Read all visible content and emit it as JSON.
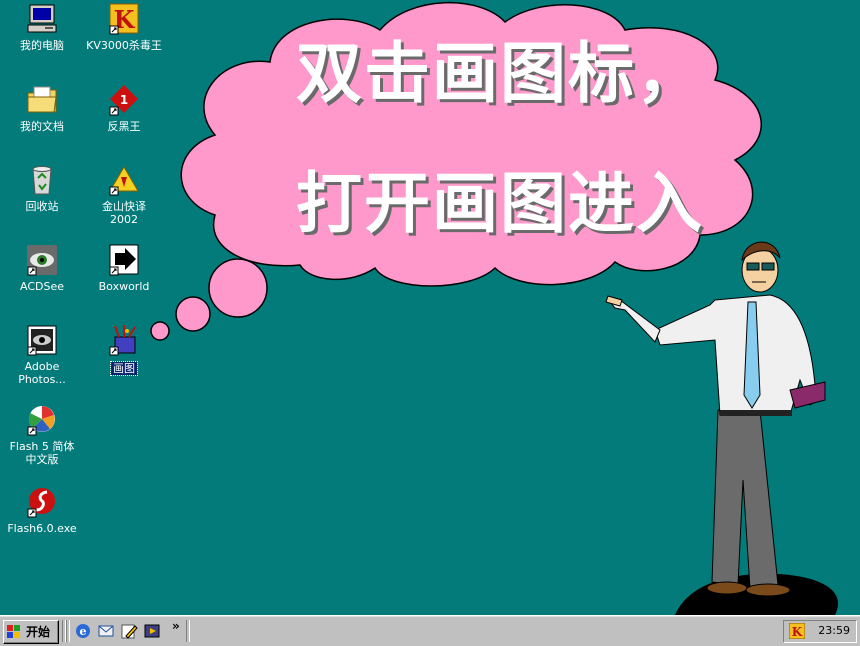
{
  "desktop": {
    "icons": [
      {
        "label": "我的电脑",
        "icon": "my-computer-icon"
      },
      {
        "label": "KV3000杀毒王",
        "icon": "kv3000-antivirus-icon"
      },
      {
        "label": "我的文档",
        "icon": "my-documents-folder-icon"
      },
      {
        "label": "反黑王",
        "icon": "anti-hacker-icon"
      },
      {
        "label": "回收站",
        "icon": "recycle-bin-icon"
      },
      {
        "label": "金山快译\n2002",
        "icon": "kingsoft-translator-icon"
      },
      {
        "label": "ACDSee",
        "icon": "acdsee-eye-icon"
      },
      {
        "label": "Boxworld",
        "icon": "boxworld-arrow-icon"
      },
      {
        "label": "Adobe\nPhotos...",
        "icon": "photoshop-eye-icon"
      },
      {
        "label": "画图",
        "icon": "paint-icon"
      },
      {
        "label": "Flash 5 简体\n中文版",
        "icon": "flash5-icon"
      },
      {
        "label": "Flash6.0.exe",
        "icon": "flash6-icon"
      }
    ]
  },
  "callout": {
    "line1": "双击画图标，",
    "line2": "打开画图进入",
    "color": "#ff99cc"
  },
  "taskbar": {
    "start_label": "开始",
    "quicklaunch": [
      "internet-explorer-icon",
      "outlook-express-icon",
      "edit-icon",
      "media-icon"
    ],
    "more": "»",
    "clock": "23:59"
  },
  "colors": {
    "desktop": "#027b7a",
    "taskbar": "#c0c0c0"
  }
}
